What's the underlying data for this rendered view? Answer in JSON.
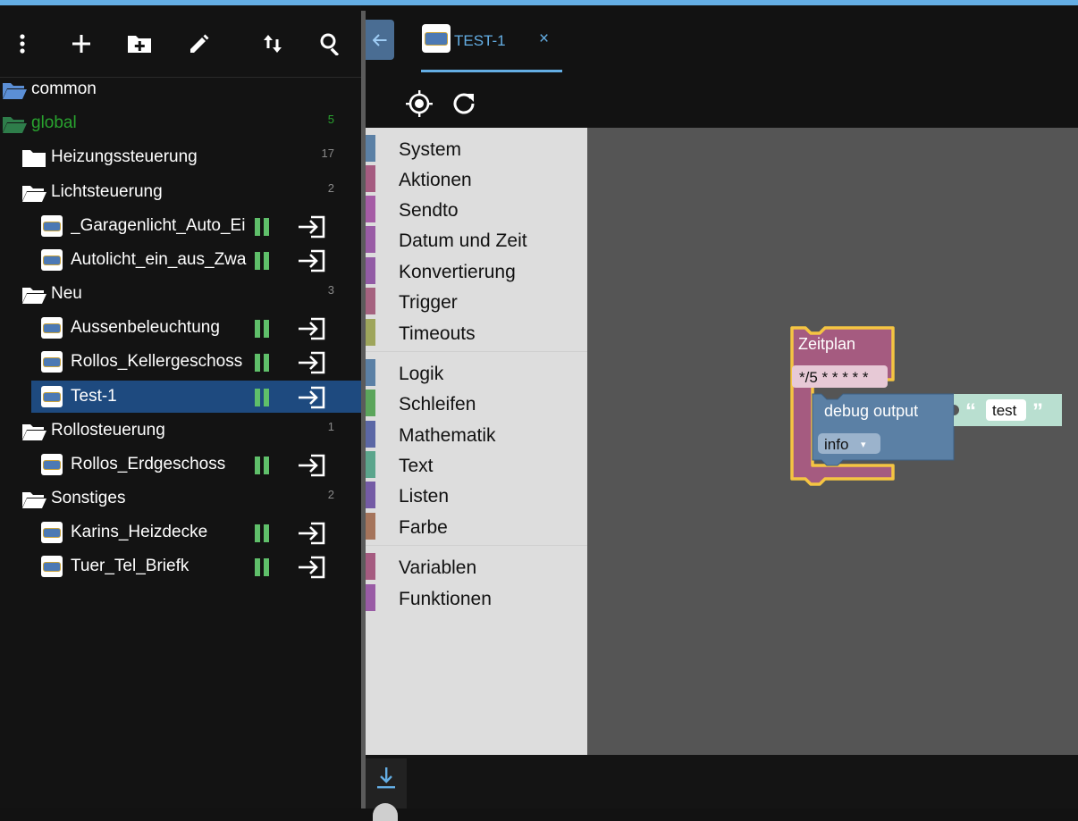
{
  "colors": {
    "accent": "#64aee4",
    "selected_row": "#1e4a7f",
    "global_folder": "#29a32f",
    "common_folder": "#5b8fd6",
    "running": "#5fbf6a",
    "workspace": "#555555",
    "toolbox": "#dddddd"
  },
  "toolbar": {
    "icons": [
      "more-vert-icon",
      "add-icon",
      "new-folder-icon",
      "edit-icon",
      "sort-icon",
      "search-icon"
    ]
  },
  "tree": {
    "common": {
      "label": "common"
    },
    "global": {
      "label": "global",
      "count": "5"
    },
    "heizung": {
      "label": "Heizungssteuerung",
      "count": "17"
    },
    "licht": {
      "label": "Lichtsteuerung",
      "count": "2",
      "items": [
        {
          "label": "_Garagenlicht_Auto_Ei"
        },
        {
          "label": "Autolicht_ein_aus_Zwa"
        }
      ]
    },
    "neu": {
      "label": "Neu",
      "count": "3",
      "items": [
        {
          "label": "Aussenbeleuchtung"
        },
        {
          "label": "Rollos_Kellergeschoss"
        },
        {
          "label": "Test-1"
        }
      ]
    },
    "rollo": {
      "label": "Rollosteuerung",
      "count": "1",
      "items": [
        {
          "label": "Rollos_Erdgeschoss"
        }
      ]
    },
    "sonst": {
      "label": "Sonstiges",
      "count": "2",
      "items": [
        {
          "label": "Karins_Heizdecke"
        },
        {
          "label": "Tuer_Tel_Briefk"
        }
      ]
    }
  },
  "tab": {
    "title": "TEST-1",
    "close": "×"
  },
  "blockly_tools": [
    "target-icon",
    "refresh-icon"
  ],
  "categories": [
    {
      "name": "System",
      "color": "#5b80a5"
    },
    {
      "name": "Aktionen",
      "color": "#a55b80"
    },
    {
      "name": "Sendto",
      "color": "#a55ba5"
    },
    {
      "name": "Datum und Zeit",
      "color": "#995ba5"
    },
    {
      "name": "Konvertierung",
      "color": "#925ba5"
    },
    {
      "name": "Trigger",
      "color": "#a5627f"
    },
    {
      "name": "Timeouts",
      "color": "#9ea55b"
    },
    {
      "name": "Logik",
      "color": "#5b80a5"
    },
    {
      "name": "Schleifen",
      "color": "#5ba55b"
    },
    {
      "name": "Mathematik",
      "color": "#5b67a5"
    },
    {
      "name": "Text",
      "color": "#5ba58c"
    },
    {
      "name": "Listen",
      "color": "#745ba5"
    },
    {
      "name": "Farbe",
      "color": "#a5745b"
    },
    {
      "name": "Variablen",
      "color": "#a55b80"
    },
    {
      "name": "Funktionen",
      "color": "#995ba5"
    }
  ],
  "blocks": {
    "schedule_title": "Zeitplan",
    "schedule_value": "*/5 * * * * *",
    "debug_label": "debug output",
    "debug_level": "info",
    "debug_level_arrow": "▾",
    "text_value": "test",
    "quote_open": "“",
    "quote_close": "”"
  }
}
